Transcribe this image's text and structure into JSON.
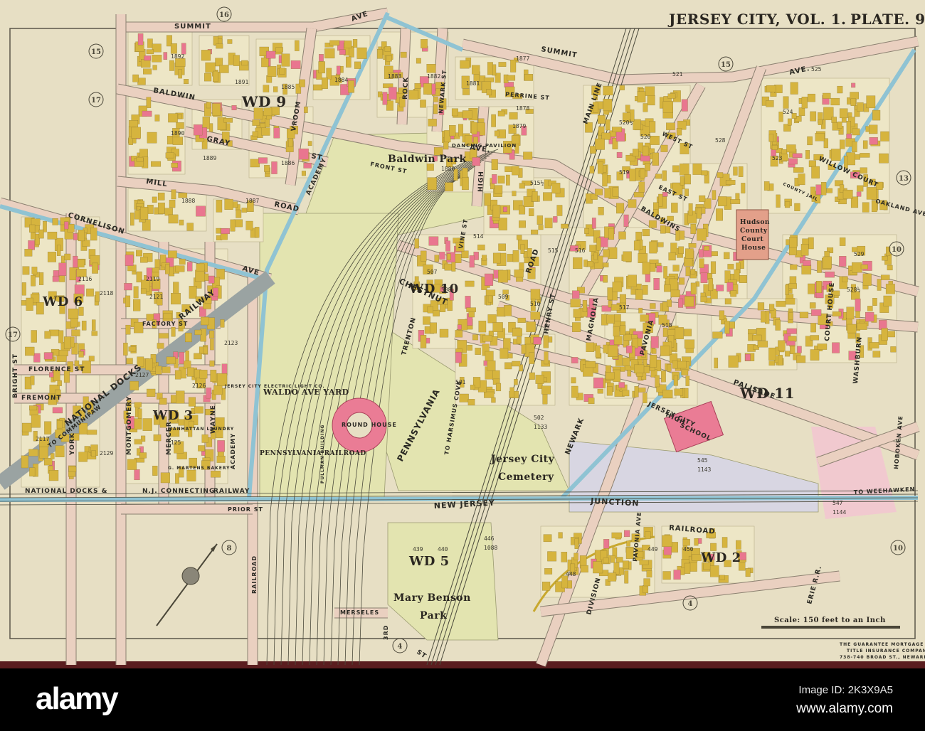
{
  "header": {
    "title": "JERSEY CITY, VOL. 1.",
    "plate": "PLATE. 9"
  },
  "streets": {
    "summit_w": "SUMMIT",
    "ave_top": "AVE",
    "summit_e": "SUMMIT",
    "ave_ne": "AVE.",
    "baldwin": "BALDWIN",
    "baldwin_ave": "AVE.",
    "baldwins": "BALDWINS",
    "gray": "GRAY",
    "st_gray": "ST",
    "mill": "MILL",
    "road": "ROAD",
    "cornelison": "CORNELISON",
    "cornelison_ave": "AVE",
    "vroom": "VROOM",
    "academy": "ACADEMY",
    "rock": "ROCK",
    "newark_st": "NEWARK ST",
    "high": "HIGH",
    "front": "FRONT ST",
    "perrine": "PERRINE ST",
    "west": "WEST ST",
    "east": "EAST ST",
    "willow": "WILLOW COURT",
    "oakland": "OAKLAND AVE",
    "chestnut": "CHESTNUT",
    "vine": "VINE ST",
    "henry": "HENRY ST",
    "magnolia": "MAGNOLIA",
    "pavonia": "PAVONIA",
    "palisade": "PALISADE",
    "court_house": "COURT HOUSE",
    "washburn": "WASHBURN",
    "hoboken": "HOBOKEN AVE",
    "newark_ave": "NEWARK",
    "trenton": "TRENTON",
    "factory": "FACTORY ST",
    "florence": "FLORENCE ST",
    "fremont": "FREMONT",
    "bright": "BRIGHT ST",
    "york": "YORK",
    "montgomery": "MONTGOMERY",
    "mercer": "MERCER",
    "wayne": "WAYNE",
    "academy_s": "ACADEMY",
    "prior": "PRIOR ST",
    "railroad_ave": "RAILROAD",
    "merseles": "MERSELES",
    "third": "3RD",
    "division": "DIVISION",
    "st_bottom": "ST",
    "pavonia_s": "PAVONIA AVE",
    "main_line": "MAIN LINE",
    "road_diag": "ROAD"
  },
  "railroads": {
    "national_docks": "NATIONAL DOCKS",
    "railway": "RAILWAY",
    "to_communipaw": "TO COMMUNIPAW",
    "nd_bottom": "NATIONAL DOCKS &",
    "nj_connecting": "N.J. CONNECTING",
    "railway_b": "RAILWAY",
    "pennsylvania": "PENNSYLVANIA",
    "new_jersey": "NEW JERSEY",
    "junction": "JUNCTION",
    "railroad": "RAILROAD",
    "erie": "ERIE R.R.",
    "to_harsimus": "TO HARSIMUS COVE",
    "weehawken": "TO WEEHAWKEN"
  },
  "landmarks": {
    "baldwin_park": "Baldwin Park",
    "dancing_pavilion": "DANCING PAVILION",
    "waldo_yard": "WALDO AVE YARD",
    "penn_rr": "PENNSYLVANIA RAILROAD",
    "round_house": "ROUND HOUSE",
    "jc_cemetery_1": "Jersey City",
    "jc_cemetery_2": "Cemetery",
    "high_school_1": "JERSEY CITY",
    "high_school_2": "HIGH",
    "high_school_3": "SCHOOL",
    "court_house_1": "Hudson",
    "court_house_2": "County",
    "court_house_3": "Court",
    "court_house_4": "House",
    "jail": "COUNTY JAIL",
    "electric_light": "JERSEY CITY ELECTRIC LIGHT CO.",
    "manhattan_laundry": "MANHATTAN LAUNDRY",
    "martens_bakery": "G. MARTENS BAKERY",
    "mary_benson_1": "Mary Benson",
    "mary_benson_2": "Park",
    "pullman": "PULLMAN BUILDING"
  },
  "wards": {
    "wd9": "WD 9",
    "wd6": "WD 6",
    "wd3": "WD 3",
    "wd10": "WD 10",
    "wd11": "WD 11",
    "wd5": "WD 5",
    "wd2": "WD 2"
  },
  "sections": [
    "15",
    "16",
    "17",
    "17",
    "15",
    "13",
    "10",
    "8",
    "4",
    "4",
    "10"
  ],
  "lots": [
    "1892",
    "1891",
    "1885",
    "1884",
    "1883",
    "1882",
    "1877",
    "1881",
    "1878",
    "1880",
    "1879",
    "1890",
    "1889",
    "1886",
    "1887",
    "1888",
    "520½",
    "521",
    "520",
    "519",
    "528",
    "524",
    "525",
    "523",
    "529",
    "528½",
    "515½",
    "514",
    "515",
    "516",
    "517",
    "518",
    "507",
    "508",
    "509",
    "510",
    "501",
    "502",
    "1133",
    "545",
    "1143",
    "547",
    "1144",
    "446",
    "1088",
    "439",
    "440",
    "449",
    "450",
    "448",
    "2116",
    "2118",
    "2119",
    "2121",
    "2125",
    "2127",
    "2129",
    "2117",
    "2123",
    "2126"
  ],
  "scale": {
    "text": "Scale: 150 feet to an Inch"
  },
  "stamp": {
    "line1": "THE GUARANTEE MORTGAGE AND",
    "line2": "TITLE INSURANCE COMPANY",
    "line3": "738-740 BROAD ST., NEWARK, N.J."
  },
  "watermark": {
    "logo": "alamy",
    "image_id": "Image ID: 2K3X9A5",
    "url": "www.alamy.com"
  },
  "colors": {
    "paper": "#e7dfc4",
    "street": "#ead0c0",
    "building": "#d6b43e",
    "brick": "#e9768f",
    "water": "#8fc3d3",
    "park": "#e3e4b0",
    "rail": "#4b4a3c"
  }
}
